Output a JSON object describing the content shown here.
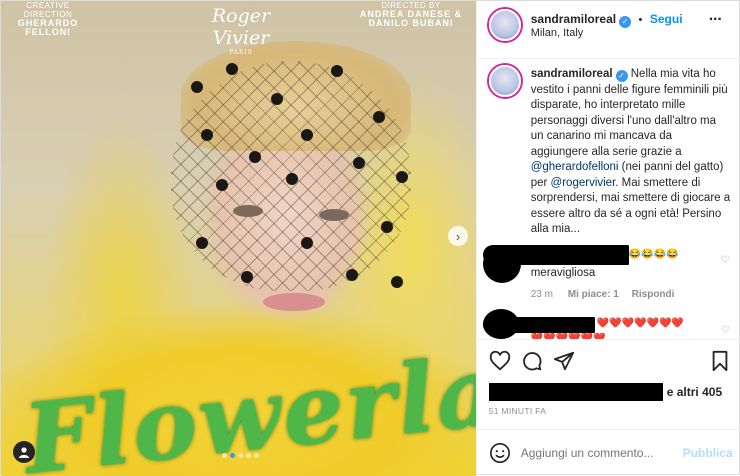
{
  "media": {
    "credit_left_label": "CREATIVE DIRECTION",
    "credit_left_name1": "GHERARDO",
    "credit_left_name2": "FELLONI",
    "brand_name": "Roger Vivier",
    "brand_city": "PARIS",
    "credit_right_label": "DIRECTED BY",
    "credit_right_name1": "ANDREA DANESE &",
    "credit_right_name2": "DANILO BUBANI",
    "overlay_word": "Flowerland",
    "next_icon": "chevron-right-icon",
    "tag_icon": "person-tag-icon",
    "carousel_slides": 5,
    "active_slide": 2
  },
  "header": {
    "username": "sandramiloreal",
    "follow_label": "Segui",
    "location": "Milan, Italy",
    "separator": "•",
    "more_label": "···"
  },
  "caption": {
    "username": "sandramiloreal",
    "text_1": " Nella mia vita ho vestito i panni delle figure femminili più disparate, ho interpretato mille personaggi diversi l'uno dall'altro ma un canarino mi mancava da aggiungere alla serie grazie a ",
    "mention_1": "@gherardofelloni",
    "text_2": " (nei panni del gatto) per ",
    "mention_2": "@rogervivier",
    "text_3": ". Mai smettere di sorprendersi, mai smettere di giocare a essere altro da sé a ogni età! Persino alla mia...",
    "time": "51 m"
  },
  "comments": [
    {
      "emojis": "😂😂😂😂",
      "text": "meravigliosa",
      "time": "23 m",
      "likes": "Mi piace: 1",
      "reply": "Rispondi"
    },
    {
      "emojis": "❤️❤️❤️❤️❤️❤️❤️",
      "second_line": "❤️❤️❤️❤️❤️❤️"
    }
  ],
  "likes": {
    "suffix_e": "e",
    "suffix_text": "altri 405"
  },
  "time_ago": "51 MINUTI FA",
  "add_comment": {
    "placeholder": "Aggiungi un commento...",
    "publish_label": "Pubblica"
  },
  "colors": {
    "accent": "#0095f6",
    "verified": "#3897f0",
    "muted": "#8e8e8e",
    "publish_disabled": "#b2dffc"
  }
}
